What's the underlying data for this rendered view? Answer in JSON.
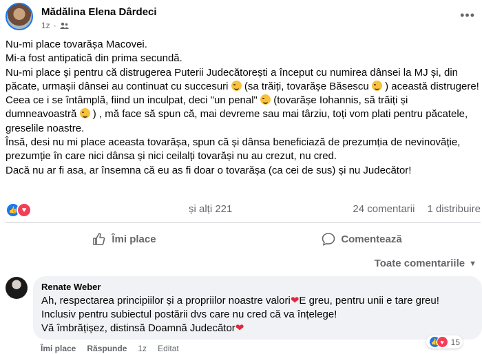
{
  "post": {
    "author": "Mădălina Elena Dârdeci",
    "time": "1z",
    "privacy_icon": "friends-icon",
    "more_icon": "more-icon",
    "paragraphs": [
      "Nu-mi place tovarășa Macovei.",
      "Mi-a fost antipatică din prima secundă.",
      "Nu-mi place și pentru că distrugerea Puterii Judecătorești a început cu numirea dânsei la MJ și, din păcate,  urmașii dânsei au continuat cu succesuri",
      " (sa trăiți, tovarășe Băsescu ",
      " ) această distrugere!",
      "Ceea ce i se întâmplă,  fiind un inculpat, deci \"un penal\" ",
      " (tovarășe Iohannis,  să trăiți și dumneavoastră ",
      " ) , mă face să spun că, mai devreme sau mai târziu, toți vom plati pentru păcatele, greselile noastre.",
      "Însă, desi nu mi place aceasta tovarășa,  spun că și dânsa beneficiază de prezumția de nevinovăție, prezumție în care nici dânsa și nici ceilalți tovarăși nu au crezut, nu cred.",
      "Dacă nu ar fi asa, ar însemna că eu as fi doar o tovarășa (ca cei de sus) și nu Judecător!"
    ]
  },
  "reactions": {
    "others": "și alți 221",
    "comments": "24 comentarii",
    "shares": "1 distribuire"
  },
  "actions": {
    "like": "Îmi place",
    "comment": "Comentează"
  },
  "sort": {
    "label": "Toate comentariile"
  },
  "comment": {
    "author": "Renate Weber",
    "line1": "Ah, respectarea principiilor și a propriilor noastre valori",
    "line1b": "E greu, pentru unii e tare greu! Inclusiv pentru subiectul postării dvs care nu cred că va înțelege!",
    "line2": "Vă îmbrățișez, distinsă Doamnă Judecător",
    "like": "Îmi place",
    "reply": "Răspunde",
    "time": "1z",
    "edited": "Editat",
    "reaction_count": "15"
  },
  "colors": {
    "accent": "#1877f2",
    "love": "#f33e58",
    "secondary_text": "#65676b",
    "bubble": "#f0f2f5"
  }
}
